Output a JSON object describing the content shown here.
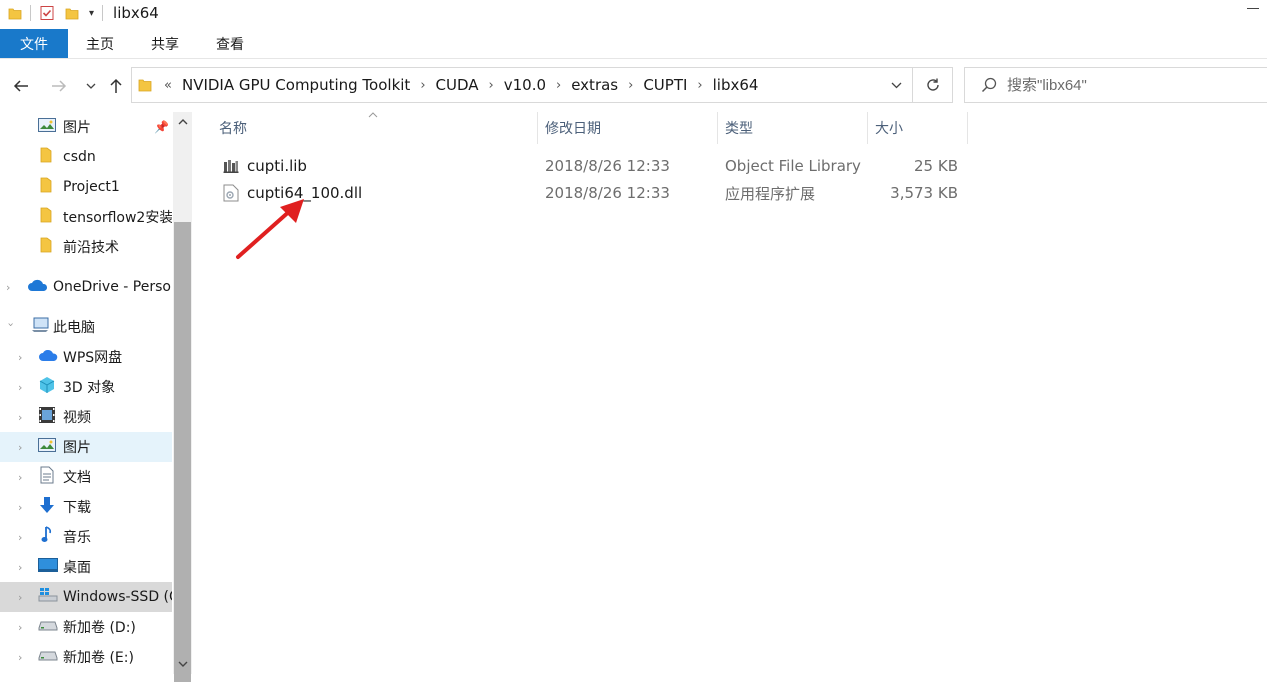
{
  "titlebar": {
    "title": "libx64"
  },
  "ribbon": {
    "file": "文件",
    "home": "主页",
    "share": "共享",
    "view": "查看"
  },
  "nav": {
    "path": [
      "NVIDIA GPU Computing Toolkit",
      "CUDA",
      "v10.0",
      "extras",
      "CUPTI",
      "libx64"
    ],
    "overflow": "«",
    "search_placeholder": "搜索\"libx64\""
  },
  "sidebar": {
    "items": [
      {
        "label": "图片",
        "icon": "pictures-icon"
      },
      {
        "label": "csdn",
        "icon": "folder-icon"
      },
      {
        "label": "Project1",
        "icon": "folder-icon"
      },
      {
        "label": "tensorflow2安装",
        "icon": "folder-icon"
      },
      {
        "label": "前沿技术",
        "icon": "folder-icon"
      },
      {
        "label": "OneDrive - Personal",
        "icon": "onedrive-icon"
      },
      {
        "label": "此电脑",
        "icon": "this-pc-icon"
      },
      {
        "label": "WPS网盘",
        "icon": "cloud-icon"
      },
      {
        "label": "3D 对象",
        "icon": "3d-objects-icon"
      },
      {
        "label": "视频",
        "icon": "video-icon"
      },
      {
        "label": "图片",
        "icon": "pictures-icon"
      },
      {
        "label": "文档",
        "icon": "documents-icon"
      },
      {
        "label": "下载",
        "icon": "downloads-icon"
      },
      {
        "label": "音乐",
        "icon": "music-icon"
      },
      {
        "label": "桌面",
        "icon": "desktop-icon"
      },
      {
        "label": "Windows-SSD (C:)",
        "icon": "windows-drive-icon"
      },
      {
        "label": "新加卷 (D:)",
        "icon": "drive-icon"
      },
      {
        "label": "新加卷 (E:)",
        "icon": "drive-icon"
      }
    ]
  },
  "list": {
    "columns": {
      "name": "名称",
      "date": "修改日期",
      "type": "类型",
      "size": "大小"
    },
    "files": [
      {
        "name": "cupti.lib",
        "date": "2018/8/26 12:33",
        "type": "Object File Library",
        "size": "25 KB",
        "icon": "lib-file-icon"
      },
      {
        "name": "cupti64_100.dll",
        "date": "2018/8/26 12:33",
        "type": "应用程序扩展",
        "size": "3,573 KB",
        "icon": "dll-file-icon"
      }
    ]
  },
  "colors": {
    "accent": "#1979ca",
    "selection": "#e5f3fb",
    "annotation": "#e02020",
    "header_text": "#4c607a"
  }
}
